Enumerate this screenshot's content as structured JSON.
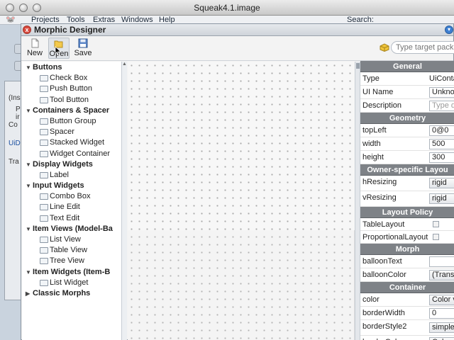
{
  "os": {
    "window_title": "Squeak4.1.image"
  },
  "menubar": {
    "logo_glyph": "🐭",
    "items": [
      "Projects",
      "Tools",
      "Extras",
      "Windows",
      "Help"
    ],
    "search_label": "Search:"
  },
  "background": {
    "fragments": [
      "(Ins",
      "P",
      "ir",
      "Co",
      "UiD",
      "Tra"
    ]
  },
  "designer": {
    "title": "Morphic Designer",
    "close_glyph": "x",
    "toolbar": {
      "new_label": "New",
      "open_label": "Open",
      "save_label": "Save",
      "package_placeholder": "Type target pack"
    },
    "tree": {
      "groups": [
        {
          "label": "Buttons",
          "items": [
            "Check Box",
            "Push Button",
            "Tool Button"
          ]
        },
        {
          "label": "Containers & Spacer",
          "items": [
            "Button Group",
            "Spacer",
            "Stacked Widget",
            "Widget Container"
          ]
        },
        {
          "label": "Display Widgets",
          "items": [
            "Label"
          ]
        },
        {
          "label": "Input Widgets",
          "items": [
            "Combo Box",
            "Line Edit",
            "Text Edit"
          ]
        },
        {
          "label": "Item Views (Model-Ba",
          "items": [
            "List View",
            "Table View",
            "Tree View"
          ]
        },
        {
          "label": "Item Widgets (Item-B",
          "items": [
            "List Widget"
          ]
        },
        {
          "label": "Classic Morphs",
          "items": []
        }
      ]
    },
    "properties": {
      "sections": [
        {
          "header": "General",
          "rows": [
            {
              "label": "Type",
              "kind": "text",
              "value": "UiConta"
            },
            {
              "label": "UI Name",
              "kind": "field",
              "value": "Unknow"
            },
            {
              "label": "Description",
              "kind": "placeholder",
              "value": "Type d"
            }
          ]
        },
        {
          "header": "Geometry",
          "rows": [
            {
              "label": "topLeft",
              "kind": "field",
              "value": "0@0"
            },
            {
              "label": "width",
              "kind": "field",
              "value": "500"
            },
            {
              "label": "height",
              "kind": "field",
              "value": "300"
            }
          ]
        },
        {
          "header": "Owner-specific Layou",
          "rows": [
            {
              "label": "hResizing",
              "kind": "dropdown",
              "value": "rigid",
              "tall": true
            },
            {
              "label": "vResizing",
              "kind": "dropdown",
              "value": "rigid",
              "tall": true
            }
          ]
        },
        {
          "header": "Layout Policy",
          "rows": [
            {
              "label": "TableLayout",
              "kind": "check",
              "value": "",
              "short": true
            },
            {
              "label": "ProportionalLayout",
              "kind": "check",
              "value": "",
              "short": true
            }
          ]
        },
        {
          "header": "Morph",
          "rows": [
            {
              "label": "balloonText",
              "kind": "field",
              "value": ""
            },
            {
              "label": "balloonColor",
              "kind": "dropdown",
              "value": "(Transp"
            }
          ]
        },
        {
          "header": "Container",
          "rows": [
            {
              "label": "color",
              "kind": "dropdown",
              "value": "Color v"
            },
            {
              "label": "borderWidth",
              "kind": "field",
              "value": "0"
            },
            {
              "label": "borderStyle2",
              "kind": "dropdown",
              "value": "simple",
              "tall": true
            },
            {
              "label": "borderColor",
              "kind": "dropdown",
              "value": "Color"
            }
          ]
        }
      ]
    }
  }
}
